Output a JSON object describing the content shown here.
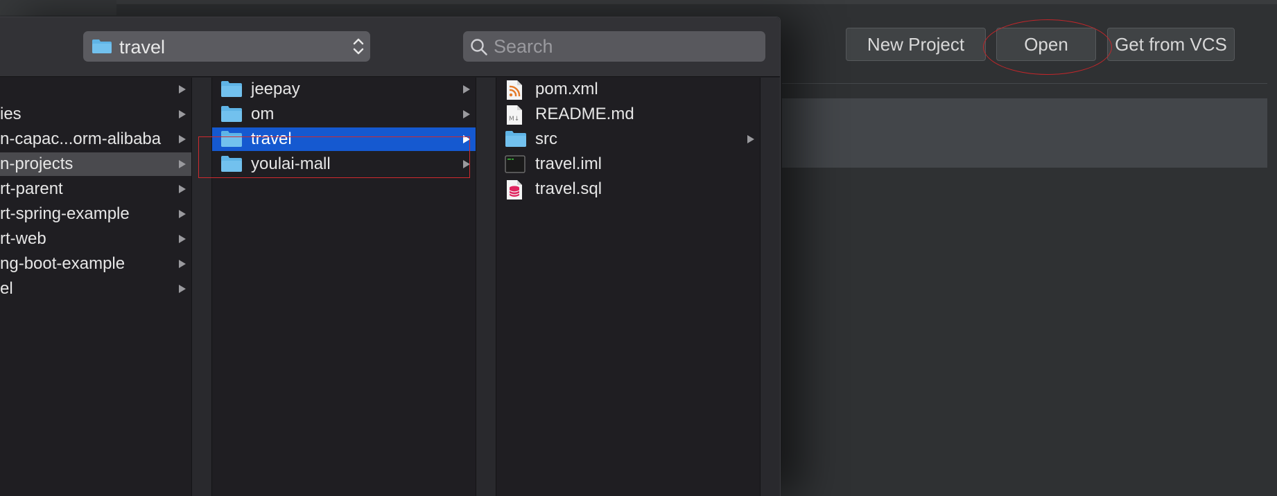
{
  "ide": {
    "buttons": {
      "new_project": "New Project",
      "open": "Open",
      "get_from_vcs": "Get from VCS"
    }
  },
  "dialog": {
    "path_popup": {
      "label": "travel"
    },
    "search": {
      "placeholder": "Search",
      "value": ""
    },
    "column1": {
      "items": [
        {
          "label": "",
          "has_children": true
        },
        {
          "label": "ies",
          "has_children": true
        },
        {
          "label": "n-capac...orm-alibaba",
          "has_children": true
        },
        {
          "label": "n-projects",
          "has_children": true,
          "selected_inactive": true
        },
        {
          "label": "rt-parent",
          "has_children": true
        },
        {
          "label": "rt-spring-example",
          "has_children": true
        },
        {
          "label": "rt-web",
          "has_children": true
        },
        {
          "label": "ng-boot-example",
          "has_children": true
        },
        {
          "label": "el",
          "has_children": true
        }
      ]
    },
    "column2": {
      "items": [
        {
          "label": "jeepay",
          "icon": "folder-icon",
          "has_children": true
        },
        {
          "label": "om",
          "icon": "folder-icon",
          "has_children": true
        },
        {
          "label": "travel",
          "icon": "folder-icon",
          "has_children": true,
          "selected": true
        },
        {
          "label": "youlai-mall",
          "icon": "folder-icon",
          "has_children": true
        }
      ]
    },
    "column3": {
      "items": [
        {
          "label": "pom.xml",
          "icon": "xml-rss-icon"
        },
        {
          "label": "README.md",
          "icon": "markdown-file-icon"
        },
        {
          "label": "src",
          "icon": "folder-icon",
          "has_children": true
        },
        {
          "label": "travel.iml",
          "icon": "terminal-file-icon"
        },
        {
          "label": "travel.sql",
          "icon": "database-file-icon"
        }
      ]
    }
  },
  "colors": {
    "selection_blue": "#1559d0",
    "annotation_red": "#d02a2e",
    "folder_blue": "#5fb4e6"
  }
}
